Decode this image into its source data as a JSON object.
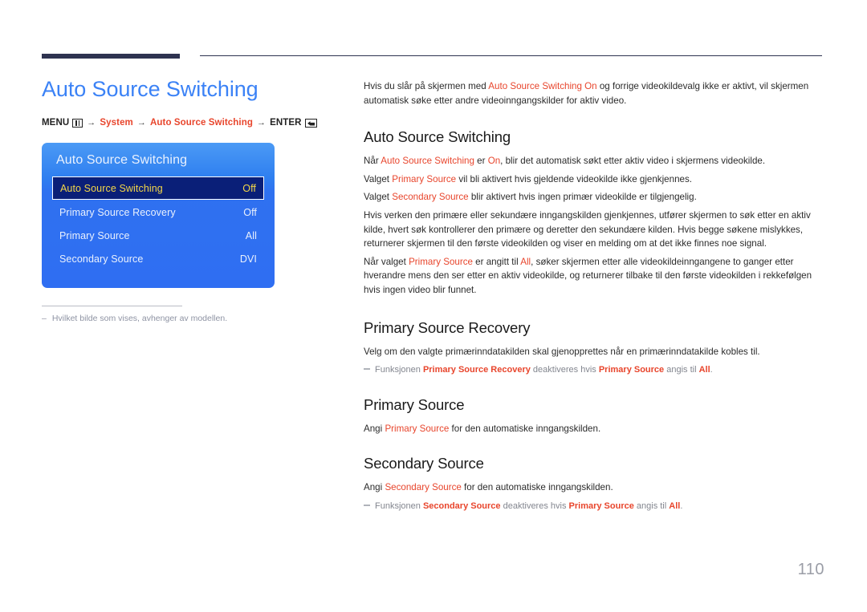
{
  "header": {
    "rule_color": "#2e3350"
  },
  "left": {
    "title": "Auto Source Switching",
    "breadcrumb": {
      "menu_label": "MENU",
      "menu_icon": "menu-bars-icon",
      "arrow1": "→",
      "system_label": "System",
      "arrow2": "→",
      "path_label": "Auto Source Switching",
      "arrow3": "→",
      "enter_label": "ENTER",
      "enter_icon": "enter-return-icon"
    },
    "osd": {
      "title": "Auto Source Switching",
      "rows": [
        {
          "label": "Auto Source Switching",
          "value": "Off",
          "selected": true
        },
        {
          "label": "Primary Source Recovery",
          "value": "Off",
          "selected": false
        },
        {
          "label": "Primary Source",
          "value": "All",
          "selected": false
        },
        {
          "label": "Secondary Source",
          "value": "DVI",
          "selected": false
        }
      ],
      "bg_gradient_top": "#4b9af5",
      "bg_gradient_bottom": "#2f6ef2",
      "selected_bg": "#0a1f78",
      "selected_text": "#f3d648"
    },
    "note": {
      "dash": "–",
      "text": "Hvilket bilde som vises, avhenger av modellen."
    }
  },
  "right": {
    "lead": {
      "pre": "Hvis du slår på skjermen med ",
      "hl": "Auto Source Switching On",
      "post": " og forrige videokildevalg ikke er aktivt, vil skjermen automatisk søke etter andre videoinngangskilder for aktiv video."
    },
    "sections": [
      {
        "heading": "Auto Source Switching",
        "p1_a": "Når ",
        "p1_hl1": "Auto Source Switching",
        "p1_b": " er ",
        "p1_hl2": "On",
        "p1_c": ", blir det automatisk søkt etter aktiv video i skjermens videokilde.",
        "p2_a": "Valget ",
        "p2_hl": "Primary Source",
        "p2_b": " vil bli aktivert hvis gjeldende videokilde ikke gjenkjennes.",
        "p3_a": "Valget ",
        "p3_hl": "Secondary Source",
        "p3_b": " blir aktivert hvis ingen primær videokilde er tilgjengelig.",
        "p4": "Hvis verken den primære eller sekundære inngangskilden gjenkjennes, utfører skjermen to søk etter en aktiv kilde, hvert søk kontrollerer den primære og deretter den sekundære kilden. Hvis begge søkene mislykkes, returnerer skjermen til den første videokilden og viser en melding om at det ikke finnes noe signal.",
        "p5_a": "Når valget ",
        "p5_hl1": "Primary Source",
        "p5_b": " er angitt til ",
        "p5_hl2": "All",
        "p5_c": ", søker skjermen etter alle videokildeinngangene to ganger etter hverandre mens den ser etter en aktiv videokilde, og returnerer tilbake til den første videokilden i rekkefølgen hvis ingen video blir funnet."
      },
      {
        "heading": "Primary Source Recovery",
        "p1": "Velg om den valgte primærinndatakilden skal gjenopprettes når en primærinndatakilde kobles til.",
        "note_a": "Funksjonen ",
        "note_hl1": "Primary Source Recovery",
        "note_b": " deaktiveres hvis ",
        "note_hl2": "Primary Source",
        "note_c": " angis til ",
        "note_hl3": "All",
        "note_d": "."
      },
      {
        "heading": "Primary Source",
        "p1_a": "Angi ",
        "p1_hl": "Primary Source",
        "p1_b": " for den automatiske inngangskilden."
      },
      {
        "heading": "Secondary Source",
        "p1_a": "Angi ",
        "p1_hl": "Secondary Source",
        "p1_b": " for den automatiske inngangskilden.",
        "note_a": "Funksjonen ",
        "note_hl1": "Secondary Source",
        "note_b": " deaktiveres hvis ",
        "note_hl2": "Primary Source",
        "note_c": " angis til ",
        "note_hl3": "All",
        "note_d": "."
      }
    ]
  },
  "footer": {
    "page_number": "110"
  },
  "colors": {
    "accent_blue": "#3b82f6",
    "accent_red": "#e8452c",
    "rule_navy": "#2e3350",
    "muted_gray": "#8e93a3"
  }
}
